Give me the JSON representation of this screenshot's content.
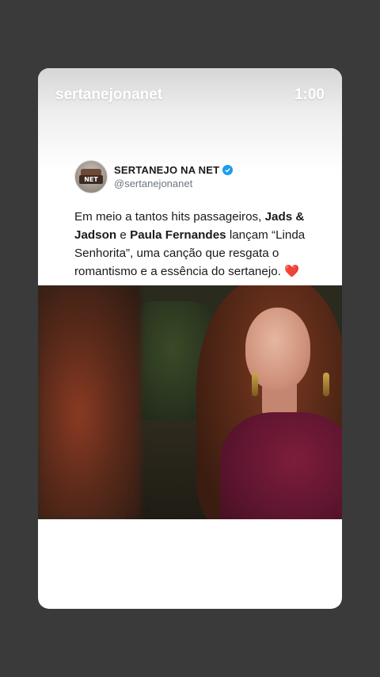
{
  "story": {
    "username": "sertanejonanet",
    "timer": "1:00"
  },
  "post": {
    "avatar_text": "NET",
    "display_name": "SERTANEJO NA NET",
    "handle": "@sertanejonanet",
    "text": {
      "p1": "Em meio a tantos hits passageiros, ",
      "b1": "Jads & Jadson",
      "p2": " e ",
      "b2": "Paula Fernandes",
      "p3": " lançam “Linda Senhorita”, uma canção que resgata o romantismo e a essência do sertanejo. ",
      "emoji": "❤️"
    }
  },
  "colors": {
    "background": "#3a3a3a",
    "card": "#ffffff",
    "verified": "#1d9bf0"
  }
}
